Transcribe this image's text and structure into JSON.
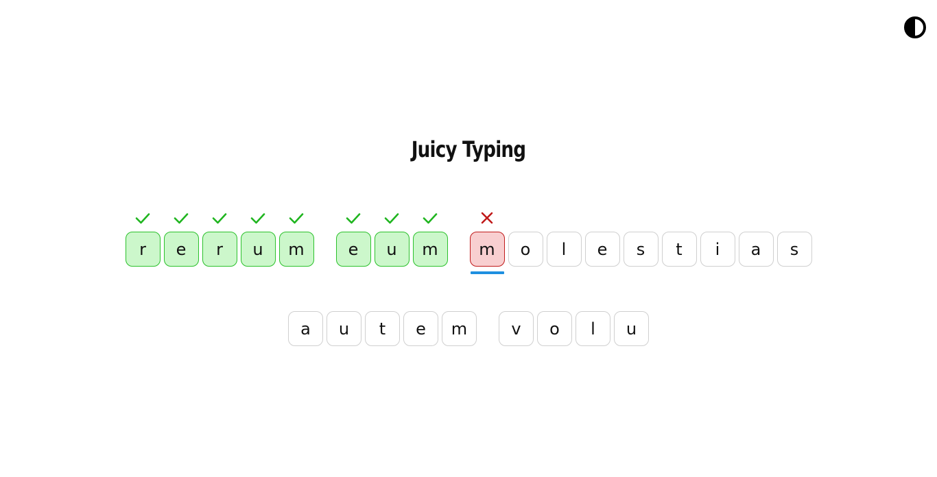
{
  "app": {
    "title": "Juicy Typing"
  },
  "theme_toggle": {
    "icon": "contrast-icon"
  },
  "colors": {
    "correct_bg": "#ccf7cb",
    "correct_border": "#2bc12b",
    "correct_mark": "#1fb51f",
    "wrong_bg": "#f8cfd0",
    "wrong_border": "#c01a1a",
    "wrong_mark": "#c01a1a",
    "caret": "#1e8fe0"
  },
  "lines": [
    {
      "words": [
        {
          "letters": [
            {
              "char": "r",
              "state": "correct"
            },
            {
              "char": "e",
              "state": "correct"
            },
            {
              "char": "r",
              "state": "correct"
            },
            {
              "char": "u",
              "state": "correct"
            },
            {
              "char": "m",
              "state": "correct"
            }
          ]
        },
        {
          "letters": [
            {
              "char": "e",
              "state": "correct"
            },
            {
              "char": "u",
              "state": "correct"
            },
            {
              "char": "m",
              "state": "correct"
            }
          ]
        },
        {
          "letters": [
            {
              "char": "m",
              "state": "wrong",
              "cursor": true
            },
            {
              "char": "o",
              "state": "pending"
            },
            {
              "char": "l",
              "state": "pending"
            },
            {
              "char": "e",
              "state": "pending"
            },
            {
              "char": "s",
              "state": "pending"
            },
            {
              "char": "t",
              "state": "pending"
            },
            {
              "char": "i",
              "state": "pending"
            },
            {
              "char": "a",
              "state": "pending"
            },
            {
              "char": "s",
              "state": "pending"
            }
          ]
        }
      ]
    },
    {
      "words": [
        {
          "letters": [
            {
              "char": "a",
              "state": "pending"
            },
            {
              "char": "u",
              "state": "pending"
            },
            {
              "char": "t",
              "state": "pending"
            },
            {
              "char": "e",
              "state": "pending"
            },
            {
              "char": "m",
              "state": "pending"
            }
          ]
        },
        {
          "letters": [
            {
              "char": "v",
              "state": "pending"
            },
            {
              "char": "o",
              "state": "pending"
            },
            {
              "char": "l",
              "state": "pending"
            },
            {
              "char": "u",
              "state": "pending"
            }
          ]
        }
      ]
    }
  ]
}
